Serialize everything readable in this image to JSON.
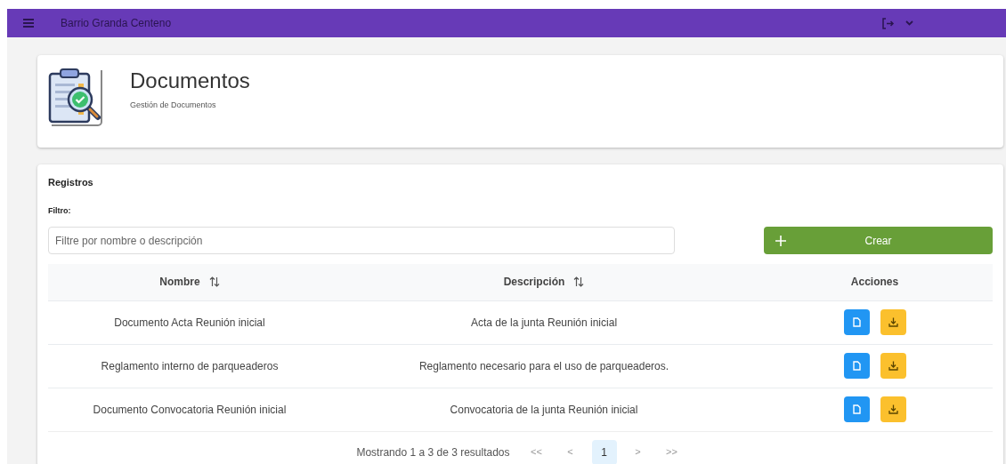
{
  "topbar": {
    "title": "Barrio Granda Centeno"
  },
  "header": {
    "title": "Documentos",
    "subtitle": "Gestión de Documentos"
  },
  "registros": {
    "title": "Registros",
    "filter_label": "Filtro:",
    "filter_placeholder": "Filtre por nombre o descripción",
    "create_button": "Crear"
  },
  "table": {
    "columns": [
      {
        "label": "Nombre",
        "sortable": true
      },
      {
        "label": "Descripción",
        "sortable": true
      },
      {
        "label": "Acciones",
        "sortable": false
      }
    ],
    "rows": [
      {
        "nombre": "Documento Acta Reunión inicial",
        "descripcion": "Acta de la junta Reunión inicial"
      },
      {
        "nombre": "Reglamento interno de parqueaderos",
        "descripcion": "Reglamento necesario para el uso de parqueaderos."
      },
      {
        "nombre": "Documento Convocatoria Reunión inicial",
        "descripcion": "Convocatoria de la junta Reunión inicial"
      }
    ]
  },
  "pagination": {
    "summary": "Mostrando 1 a 3 de 3 resultados",
    "controls": [
      {
        "label": "<<",
        "kind": "nav",
        "selected": false
      },
      {
        "label": "<",
        "kind": "nav",
        "selected": false
      },
      {
        "label": "1",
        "kind": "page",
        "selected": true
      },
      {
        "label": ">",
        "kind": "nav",
        "selected": false
      },
      {
        "label": ">>",
        "kind": "nav",
        "selected": false
      }
    ]
  }
}
